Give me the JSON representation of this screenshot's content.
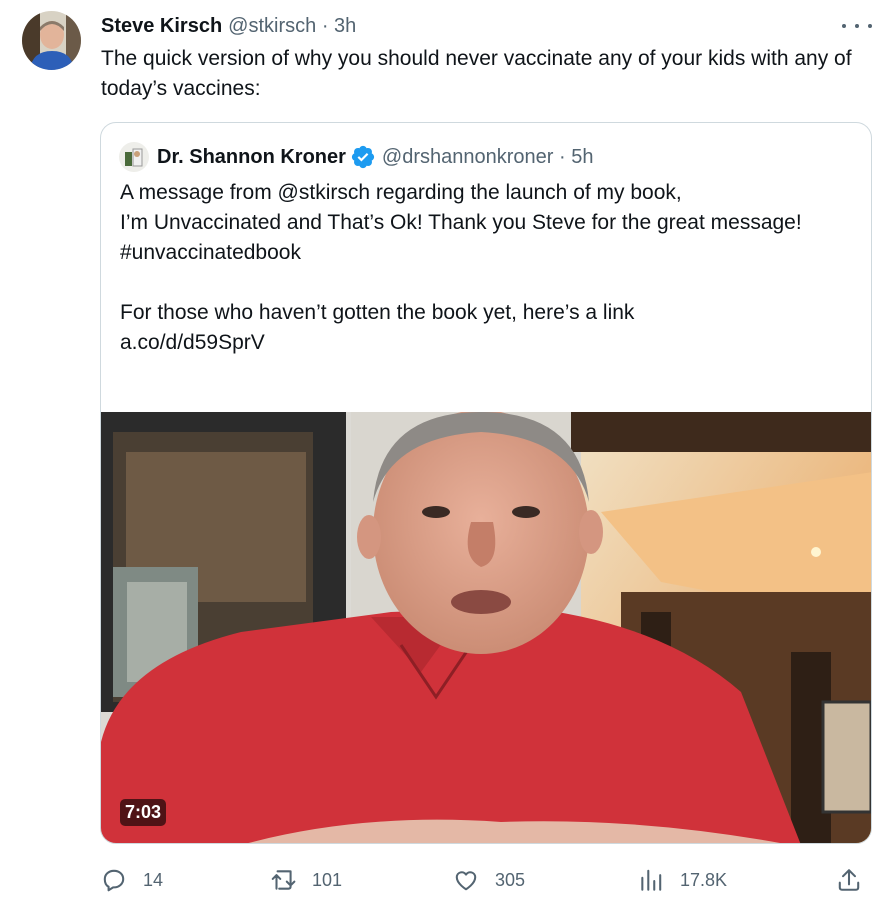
{
  "tweet": {
    "author_name": "Steve Kirsch",
    "author_meta": "@stkirsch · 3h",
    "text": "The quick version of why you should never vaccinate any of your kids with any of today’s vaccines:"
  },
  "quote": {
    "author_name": "Dr. Shannon Kroner",
    "author_meta": "@drshannonkroner · 5h",
    "text": "A message from @stkirsch  regarding the launch of my book,\nI’m Unvaccinated and That’s Ok! Thank you Steve for the great message!\n#unvaccinatedbook\n\nFor those who haven’t gotten the book yet, here’s a link\n a.co/d/d59SprV",
    "video_duration": "7:03"
  },
  "actions": {
    "replies": "14",
    "reposts": "101",
    "likes": "305",
    "views": "17.8K"
  },
  "colors": {
    "text": "#0f1419",
    "muted": "#536471",
    "border": "#cfd9de",
    "verified": "#1d9bf0"
  },
  "icons": [
    "more-icon",
    "verified-icon",
    "reply-icon",
    "repost-icon",
    "like-icon",
    "views-icon",
    "share-icon"
  ]
}
